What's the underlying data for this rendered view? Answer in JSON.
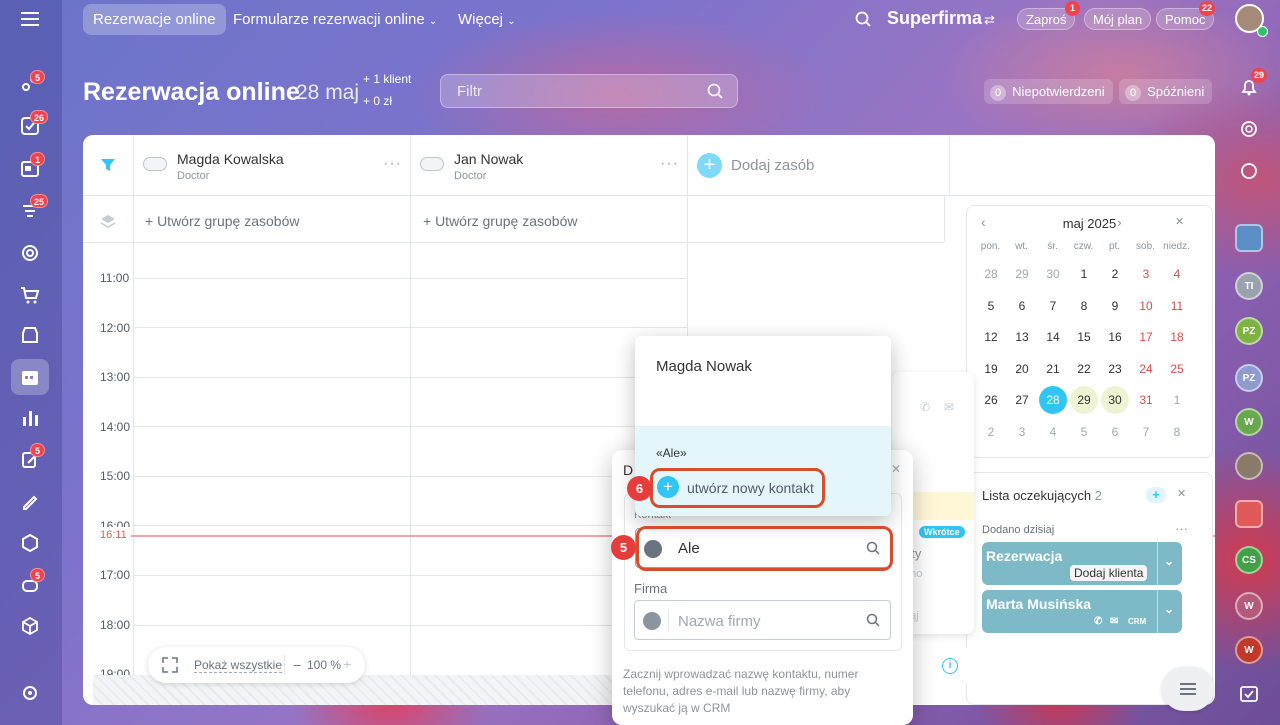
{
  "topbar": {
    "tabs": [
      "Rezerwacje online",
      "Formularze rezerwacji online",
      "Więcej"
    ],
    "company": "Superfirma",
    "invite": {
      "label": "Zaproś",
      "badge": "1"
    },
    "my_plan": "Mój plan",
    "help": {
      "label": "Pomoc",
      "badge": "22"
    }
  },
  "left_sidebar": {
    "badges": [
      "5",
      "26",
      "1",
      "25",
      "5",
      "5"
    ]
  },
  "right_sidebar": {
    "notif_badge": "29",
    "avatars": [
      "TI",
      "PZ",
      "PZ",
      "W",
      "CS",
      "W",
      "W"
    ]
  },
  "header": {
    "title": "Rezerwacja online",
    "date": "28 maj",
    "stats": [
      "+ 1 klient",
      "+ 0 zł"
    ],
    "filter_placeholder": "Filtr",
    "unconfirmed": {
      "count": "0",
      "label": "Niepotwierdzeni"
    },
    "late": {
      "count": "0",
      "label": "Spóźnieni"
    }
  },
  "resources": [
    {
      "name": "Magda Kowalska",
      "role": "Doctor",
      "group_label": "+ Utwórz grupę zasobów"
    },
    {
      "name": "Jan Nowak",
      "role": "Doctor",
      "group_label": "+ Utwórz grupę zasobów"
    }
  ],
  "add_resource": "Dodaj zasób",
  "times": [
    "11:00",
    "12:00",
    "13:00",
    "14:00",
    "15:00",
    "16:00",
    "17:00",
    "18:00",
    "19:00"
  ],
  "current_time": "16:11",
  "zoom": {
    "show_all": "Pokaż wszystkie",
    "minus": "−",
    "level": "100 %",
    "plus": "+"
  },
  "calendar": {
    "month": "maj 2025",
    "weekdays": [
      "pon.",
      "wt.",
      "śr.",
      "czw.",
      "pt.",
      "sob.",
      "niedz."
    ],
    "weeks": [
      [
        "28",
        "29",
        "30",
        "1",
        "2",
        "3",
        "4"
      ],
      [
        "5",
        "6",
        "7",
        "8",
        "9",
        "10",
        "11"
      ],
      [
        "12",
        "13",
        "14",
        "15",
        "16",
        "17",
        "18"
      ],
      [
        "19",
        "20",
        "21",
        "22",
        "23",
        "24",
        "25"
      ],
      [
        "26",
        "27",
        "28",
        "29",
        "30",
        "31",
        "1"
      ],
      [
        "2",
        "3",
        "4",
        "5",
        "6",
        "7",
        "8"
      ]
    ],
    "selected": "28"
  },
  "waitlist": {
    "title": "Lista oczekujących",
    "count": "2",
    "section": "Dodano dzisiaj",
    "cards": [
      {
        "title": "Rezerwacja",
        "button": "Dodaj klienta"
      },
      {
        "title": "Marta Musińska",
        "tag": "CRM"
      }
    ]
  },
  "side_panel": {
    "badge": "Wkrótce",
    "fragment": "nty",
    "text1": "ano",
    "text2": "dąj"
  },
  "popup": {
    "header_initial": "D",
    "contact_label": "Kontakt",
    "contact_value": "Ale",
    "company_label": "Firma",
    "company_placeholder": "Nazwa firmy",
    "hint": "Zacznij wprowadzać nazwę kontaktu, numer telefonu, adres e-mail lub nazwę firmy, aby wyszukać ją w CRM"
  },
  "dropdown": {
    "suggestion": "Magda Nowak",
    "query": "«Ale»",
    "create_label": "utwórz nowy kontakt"
  },
  "steps": [
    "5",
    "6"
  ],
  "colors": {
    "accent": "#2fc6f6",
    "step": "#e63c3c",
    "box": "#d84b2b",
    "now_line": "#f4a3a3"
  }
}
